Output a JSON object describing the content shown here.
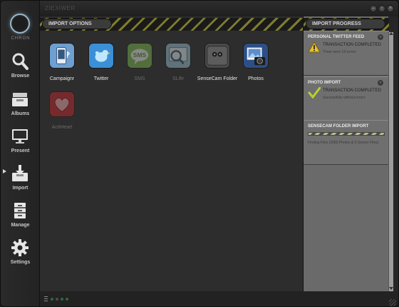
{
  "window": {
    "title": "ZIEXIWER"
  },
  "brand": {
    "logo_text": "CHRON"
  },
  "sidebar": {
    "active_item": "Import",
    "items": [
      {
        "label": "Browse",
        "icon": "magnifier-icon"
      },
      {
        "label": "Albums",
        "icon": "inbox-tray-icon"
      },
      {
        "label": "Present",
        "icon": "monitor-icon"
      },
      {
        "label": "Import",
        "icon": "import-tray-icon"
      },
      {
        "label": "Manage",
        "icon": "file-cabinet-icon"
      },
      {
        "label": "Settings",
        "icon": "gear-icon"
      }
    ]
  },
  "import_options": {
    "title": "IMPORT OPTIONS",
    "tiles": [
      {
        "label": "Campaignr",
        "enabled": true,
        "icon": "phone-bluetooth-icon"
      },
      {
        "label": "Twitter",
        "enabled": true,
        "icon": "twitter-bird-icon"
      },
      {
        "label": "SMS",
        "enabled": false,
        "icon": "sms-bubble-icon"
      },
      {
        "label": "SLife",
        "enabled": false,
        "icon": "slife-magnifier-icon"
      },
      {
        "label": "SenseCam Folder",
        "enabled": true,
        "icon": "sensecam-icon"
      },
      {
        "label": "Photos",
        "enabled": true,
        "icon": "camera-photo-icon"
      },
      {
        "label": "ActiHeart",
        "enabled": false,
        "icon": "heart-icon"
      }
    ]
  },
  "import_progress": {
    "title": "IMPORT PROGRESS",
    "cards": [
      {
        "title": "PERSONAL TWITTER FEED",
        "status": "TRANSACTION COMPLETED",
        "detail": "Three were 19 errors",
        "icon": "warning-icon"
      },
      {
        "title": "PHOTO IMPORT",
        "status": "TRANSACTION COMPLETED",
        "detail": "Successfully without errors",
        "icon": "checkmark-icon"
      },
      {
        "title": "SENSECAM FOLDER IMPORT",
        "status": "",
        "detail": "Finding Files (2083 Photos & 6 Sensor Files)",
        "icon": "progress-bar-icon"
      }
    ]
  },
  "colors": {
    "hazard_yellow": "#7e7c2e",
    "panel_gray": "#6f6f6f",
    "sidebar_dark": "#262626"
  }
}
